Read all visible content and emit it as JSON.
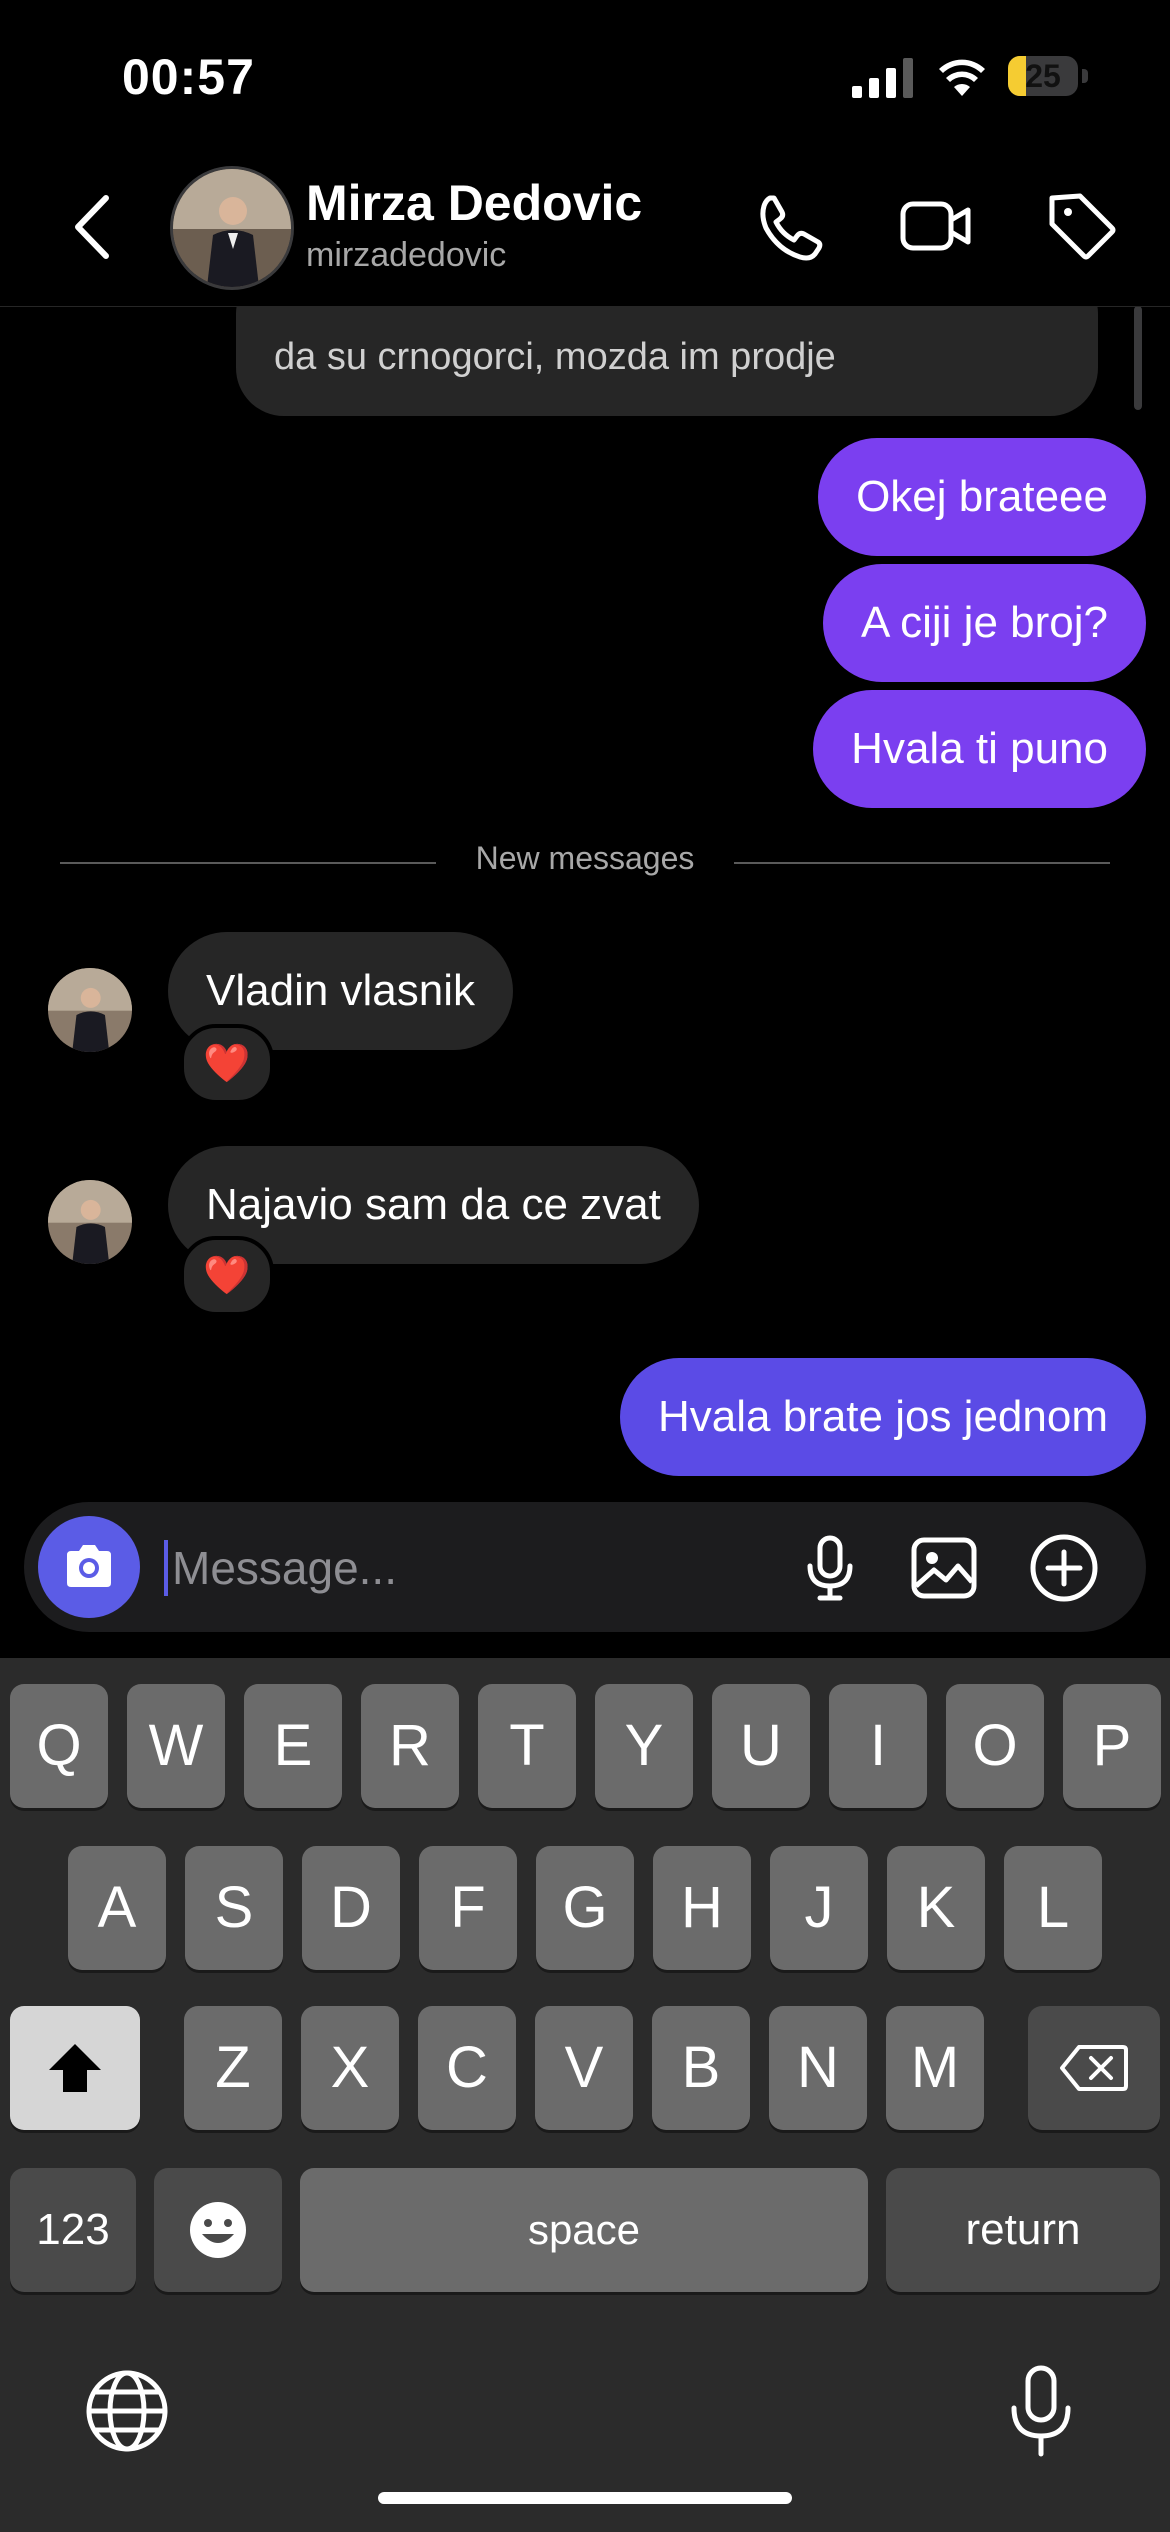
{
  "status_bar": {
    "time": "00:57",
    "battery_percent": "25",
    "battery_level": 0.25
  },
  "header": {
    "name": "Mirza Dedovic",
    "username": "mirzadedovic",
    "icons": [
      "back-chevron-icon",
      "phone-icon",
      "video-icon",
      "tag-icon"
    ]
  },
  "chat": {
    "previous_partial_message": "da su crnogorci, mozda im prodje",
    "messages": [
      {
        "direction": "outgoing",
        "text": "Okej brateee"
      },
      {
        "direction": "outgoing",
        "text": "A ciji je broj?"
      },
      {
        "direction": "outgoing",
        "text": "Hvala ti puno"
      },
      {
        "direction": "incoming",
        "text": "Vladin vlasnik",
        "reaction": "❤️"
      },
      {
        "direction": "incoming",
        "text": "Najavio sam da ce zvat",
        "reaction": "❤️"
      },
      {
        "direction": "outgoing",
        "text": "Hvala brate jos jednom"
      }
    ],
    "new_messages_label": "New messages"
  },
  "composer": {
    "placeholder": "Message...",
    "icons": [
      "camera-icon",
      "microphone-icon",
      "gallery-icon",
      "plus-circle-icon"
    ]
  },
  "keyboard": {
    "row1": [
      "Q",
      "W",
      "E",
      "R",
      "T",
      "Y",
      "U",
      "I",
      "O",
      "P"
    ],
    "row2": [
      "A",
      "S",
      "D",
      "F",
      "G",
      "H",
      "J",
      "K",
      "L"
    ],
    "row3": [
      "Z",
      "X",
      "C",
      "V",
      "B",
      "N",
      "M"
    ],
    "numbers_key": "123",
    "space_key": "space",
    "return_key": "return"
  },
  "colors": {
    "outgoing": "#7b3ff0",
    "outgoing_latest": "#5b4be6",
    "incoming": "#262626",
    "accent": "#5b5ce6"
  }
}
